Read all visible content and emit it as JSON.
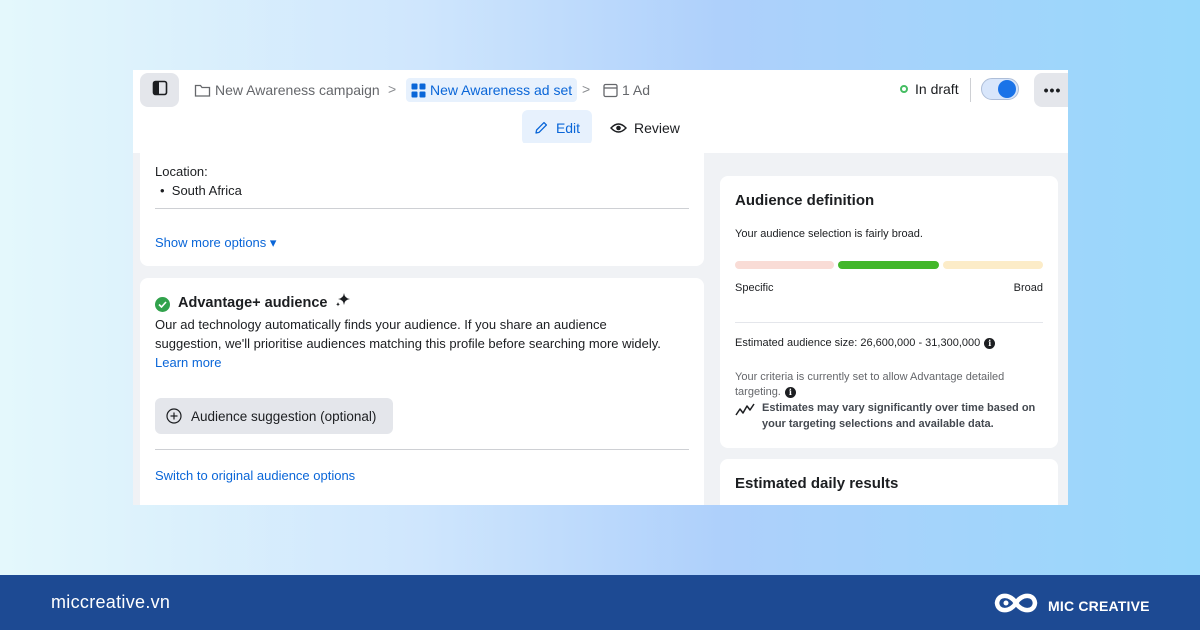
{
  "breadcrumb": {
    "campaign": "New Awareness campaign",
    "ad_set": "New Awareness ad set",
    "ad": "1 Ad"
  },
  "status": {
    "label": "In draft",
    "toggle_on": true
  },
  "mode_tabs": {
    "edit": "Edit",
    "review": "Review"
  },
  "location_card": {
    "label": "Location:",
    "items": [
      "South Africa"
    ],
    "show_more": "Show more options ▾"
  },
  "advantage_card": {
    "title": "Advantage+ audience",
    "description_lines": [
      "Our ad technology automatically finds your audience. If you share an audience",
      "suggestion, we'll prioritise audiences matching this profile before searching more widely."
    ],
    "learn_more": "Learn more",
    "suggestion_button": "Audience suggestion (optional)",
    "switch_link": "Switch to original audience options"
  },
  "audience_definition": {
    "title": "Audience definition",
    "summary": "Your audience selection is fairly broad.",
    "meter_left": "Specific",
    "meter_right": "Broad",
    "estimated_size_label": "Estimated audience size: 26,600,000 - 31,300,000",
    "criteria_lines": [
      "Your criteria is currently set to allow Advantage detailed",
      "targeting."
    ],
    "estimate_note_lines": [
      "Estimates may vary significantly over time based on",
      "your targeting selections and available data."
    ]
  },
  "estimated_results": {
    "title": "Estimated daily results"
  },
  "footer": {
    "site": "miccreative.vn",
    "brand": "MIC CREATIVE"
  },
  "colors": {
    "accent": "#0a66d8",
    "draft_status": "#45bd62",
    "meter_active": "#42b72a",
    "meter_specific": "#f9dcd6",
    "meter_broad": "#fcecc8",
    "footer_bg": "#1d4a93"
  }
}
